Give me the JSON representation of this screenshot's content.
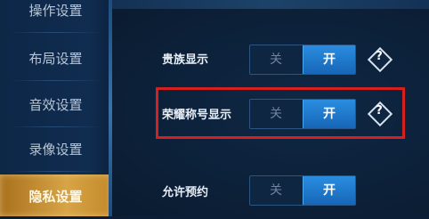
{
  "sidebar": {
    "items": [
      {
        "label": "操作设置",
        "active": false
      },
      {
        "label": "布局设置",
        "active": false
      },
      {
        "label": "音效设置",
        "active": false
      },
      {
        "label": "录像设置",
        "active": false
      },
      {
        "label": "隐私设置",
        "active": true
      }
    ]
  },
  "settings": [
    {
      "label": "贵族显示",
      "off_label": "关",
      "on_label": "开",
      "value": "开",
      "help": "?"
    },
    {
      "label": "荣耀称号显示",
      "off_label": "关",
      "on_label": "开",
      "value": "开",
      "help": "?",
      "highlighted": true
    },
    {
      "label": "允许预约",
      "off_label": "关",
      "on_label": "开",
      "value": "开"
    }
  ],
  "colors": {
    "active_tab": "#d7a446",
    "toggle_on": "#2a8de0",
    "highlight_box": "#d62020",
    "background": "#0b1e35"
  }
}
